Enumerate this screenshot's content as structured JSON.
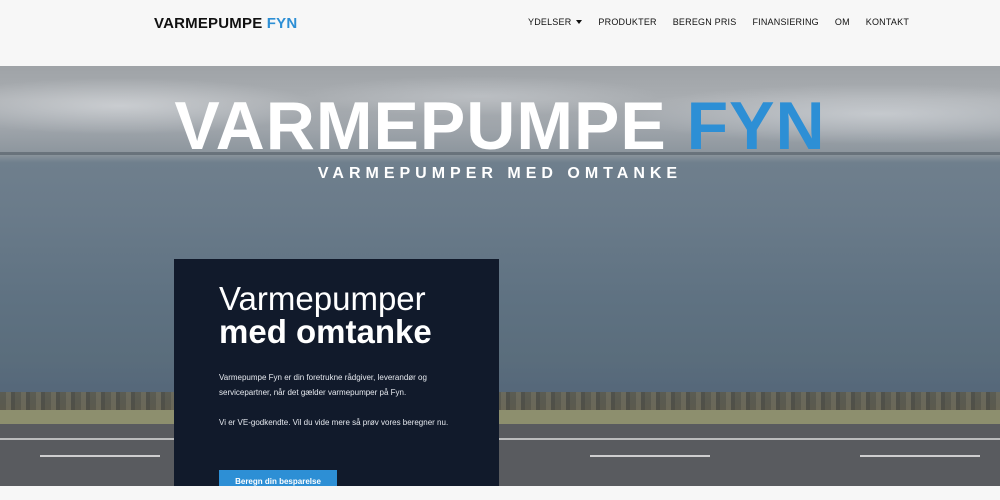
{
  "header": {
    "logo_main": "VARMEPUMPE",
    "logo_accent": "FYN",
    "nav": [
      {
        "label": "YDELSER",
        "has_dropdown": true
      },
      {
        "label": "PRODUKTER"
      },
      {
        "label": "BEREGN PRIS"
      },
      {
        "label": "FINANSIERING"
      },
      {
        "label": "OM"
      },
      {
        "label": "KONTAKT"
      }
    ]
  },
  "hero": {
    "title_main": "VARMEPUMPE",
    "title_accent": "FYN",
    "subtitle": "VARMEPUMPER MED OMTANKE"
  },
  "card": {
    "title_light": "Varmepumper",
    "title_bold": "med omtanke",
    "paragraph1": "Varmepumpe Fyn er din foretrukne rådgiver, leverandør og servicepartner, når det gælder varmepumper på Fyn.",
    "paragraph2": "Vi er VE-godkendte. Vil du vide mere så prøv vores beregner nu.",
    "cta_label": "Beregn din besparelse"
  },
  "colors": {
    "accent": "#2d8fd5",
    "card_bg": "#111a2b",
    "header_bg": "#f7f7f7"
  }
}
